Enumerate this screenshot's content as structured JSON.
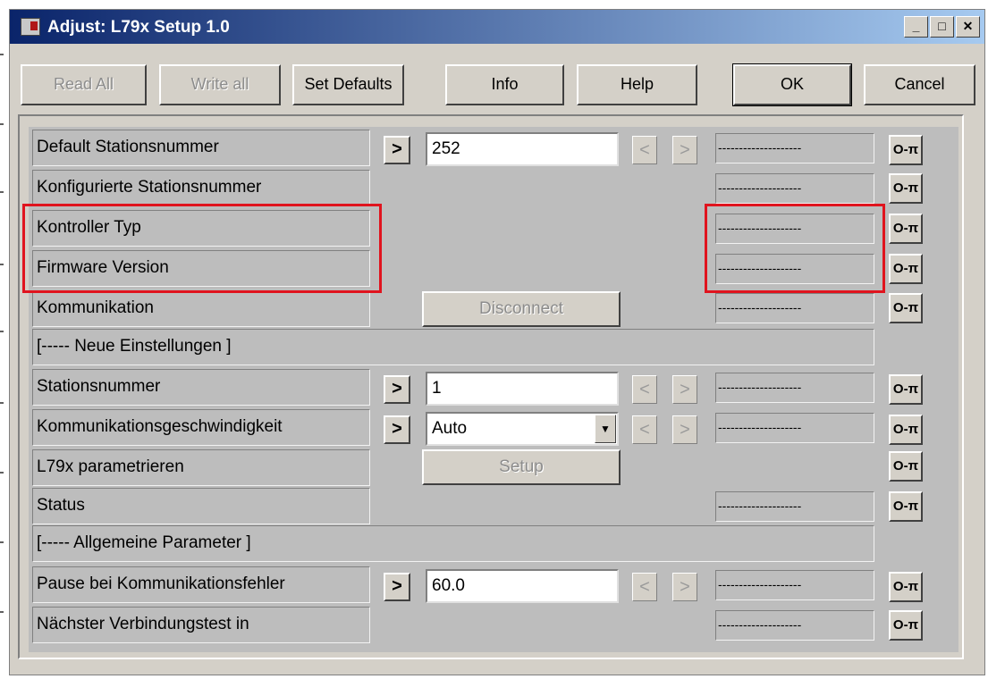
{
  "window": {
    "title": "Adjust: L79x Setup 1.0",
    "min": "_",
    "max": "□",
    "close": "✕"
  },
  "toolbar": {
    "read_all": "Read All",
    "write_all": "Write all",
    "set_defaults": "Set Defaults",
    "info": "Info",
    "help": "Help",
    "ok": "OK",
    "cancel": "Cancel"
  },
  "glyphs": {
    "arrow_right": ">",
    "nav_left": "<",
    "nav_right": ">",
    "key": "O‑π",
    "dropdown": "▼"
  },
  "rows": {
    "default_station": {
      "label": "Default Stationsnummer",
      "value": "252",
      "display": "--------------------"
    },
    "configured_station": {
      "label": "Konfigurierte Stationsnummer",
      "display": "--------------------"
    },
    "controller_type": {
      "label": "Kontroller Typ",
      "display": "--------------------"
    },
    "firmware": {
      "label": "Firmware Version",
      "display": "--------------------"
    },
    "communication": {
      "label": "Kommunikation",
      "button": "Disconnect",
      "display": "--------------------"
    },
    "section_new": {
      "label": "[----- Neue Einstellungen ]"
    },
    "station": {
      "label": "Stationsnummer",
      "value": "1",
      "display": "--------------------"
    },
    "comm_speed": {
      "label": "Kommunikationsgeschwindigkeit",
      "value": "Auto",
      "display": "--------------------"
    },
    "parametrize": {
      "label": "L79x parametrieren",
      "button": "Setup"
    },
    "status": {
      "label": "Status",
      "display": "--------------------"
    },
    "section_general": {
      "label": "[----- Allgemeine Parameter ]"
    },
    "pause": {
      "label": "Pause bei Kommunikationsfehler",
      "value": "60.0",
      "display": "--------------------"
    },
    "next_test": {
      "label": "Nächster Verbindungstest in",
      "display": "--------------------"
    }
  },
  "colors": {
    "title_start": "#0a246a",
    "title_end": "#a6caf0",
    "highlight": "#e0141e",
    "face": "#d4d0c8",
    "grid": "#bdbdbd"
  }
}
